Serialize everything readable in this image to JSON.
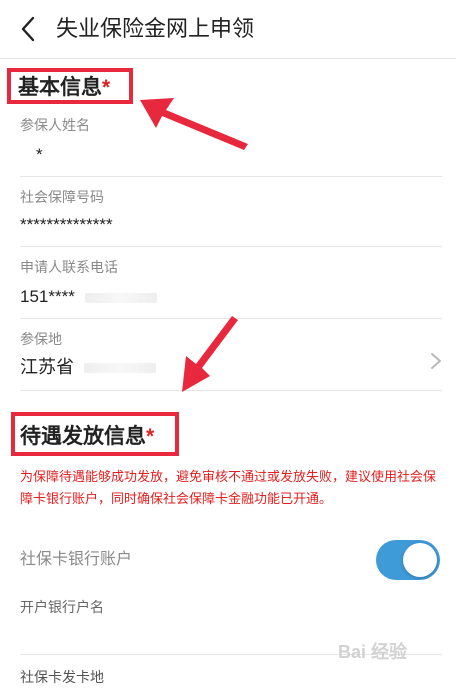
{
  "header": {
    "title": "失业保险金网上申领",
    "back_icon": "chevron-left-icon"
  },
  "section_basic": {
    "title": "基本信息",
    "required_mark": "*"
  },
  "fields": {
    "insured_name": {
      "label": "参保人姓名",
      "value": "*"
    },
    "social_security_no": {
      "label": "社会保障号码",
      "value": "**************"
    },
    "phone": {
      "label": "申请人联系电话",
      "value": "151****"
    },
    "insured_place": {
      "label": "参保地",
      "value": "江苏省"
    }
  },
  "section_payment": {
    "title": "待遇发放信息",
    "required_mark": "*"
  },
  "notice": "为保障待遇能够成功发放，避免审核不通过或发放失败，建议使用社会保障卡银行账户，同时确保社会保障卡金融功能已开通。",
  "payment": {
    "bank_account_label": "社保卡银行账户",
    "bank_account_toggle_on": true,
    "account_holder_label": "开户银行户名",
    "card_issue_place_label": "社保卡发卡地"
  },
  "watermark": "Bai 经验",
  "colors": {
    "highlight": "#e8283c",
    "toggle_on": "#3f9ad8",
    "notice": "#e02020"
  }
}
